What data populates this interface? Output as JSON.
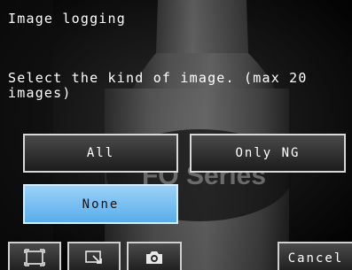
{
  "screen": {
    "title": "Image logging",
    "instruction": "Select the kind of image. (max 20\nimages)",
    "background_watermark": "FQ Series"
  },
  "options": {
    "all_label": "All",
    "only_ng_label": "Only NG",
    "none_label": "None",
    "selected": "None"
  },
  "toolbar": {
    "zoom_fit_icon": "zoom-fit-icon",
    "zoom_area_icon": "zoom-area-icon",
    "capture_icon": "camera-icon",
    "cancel_label": "Cancel"
  },
  "colors": {
    "selected_button": "#6db9f0",
    "button_border": "#d8d8d8",
    "text": "#ffffff"
  }
}
